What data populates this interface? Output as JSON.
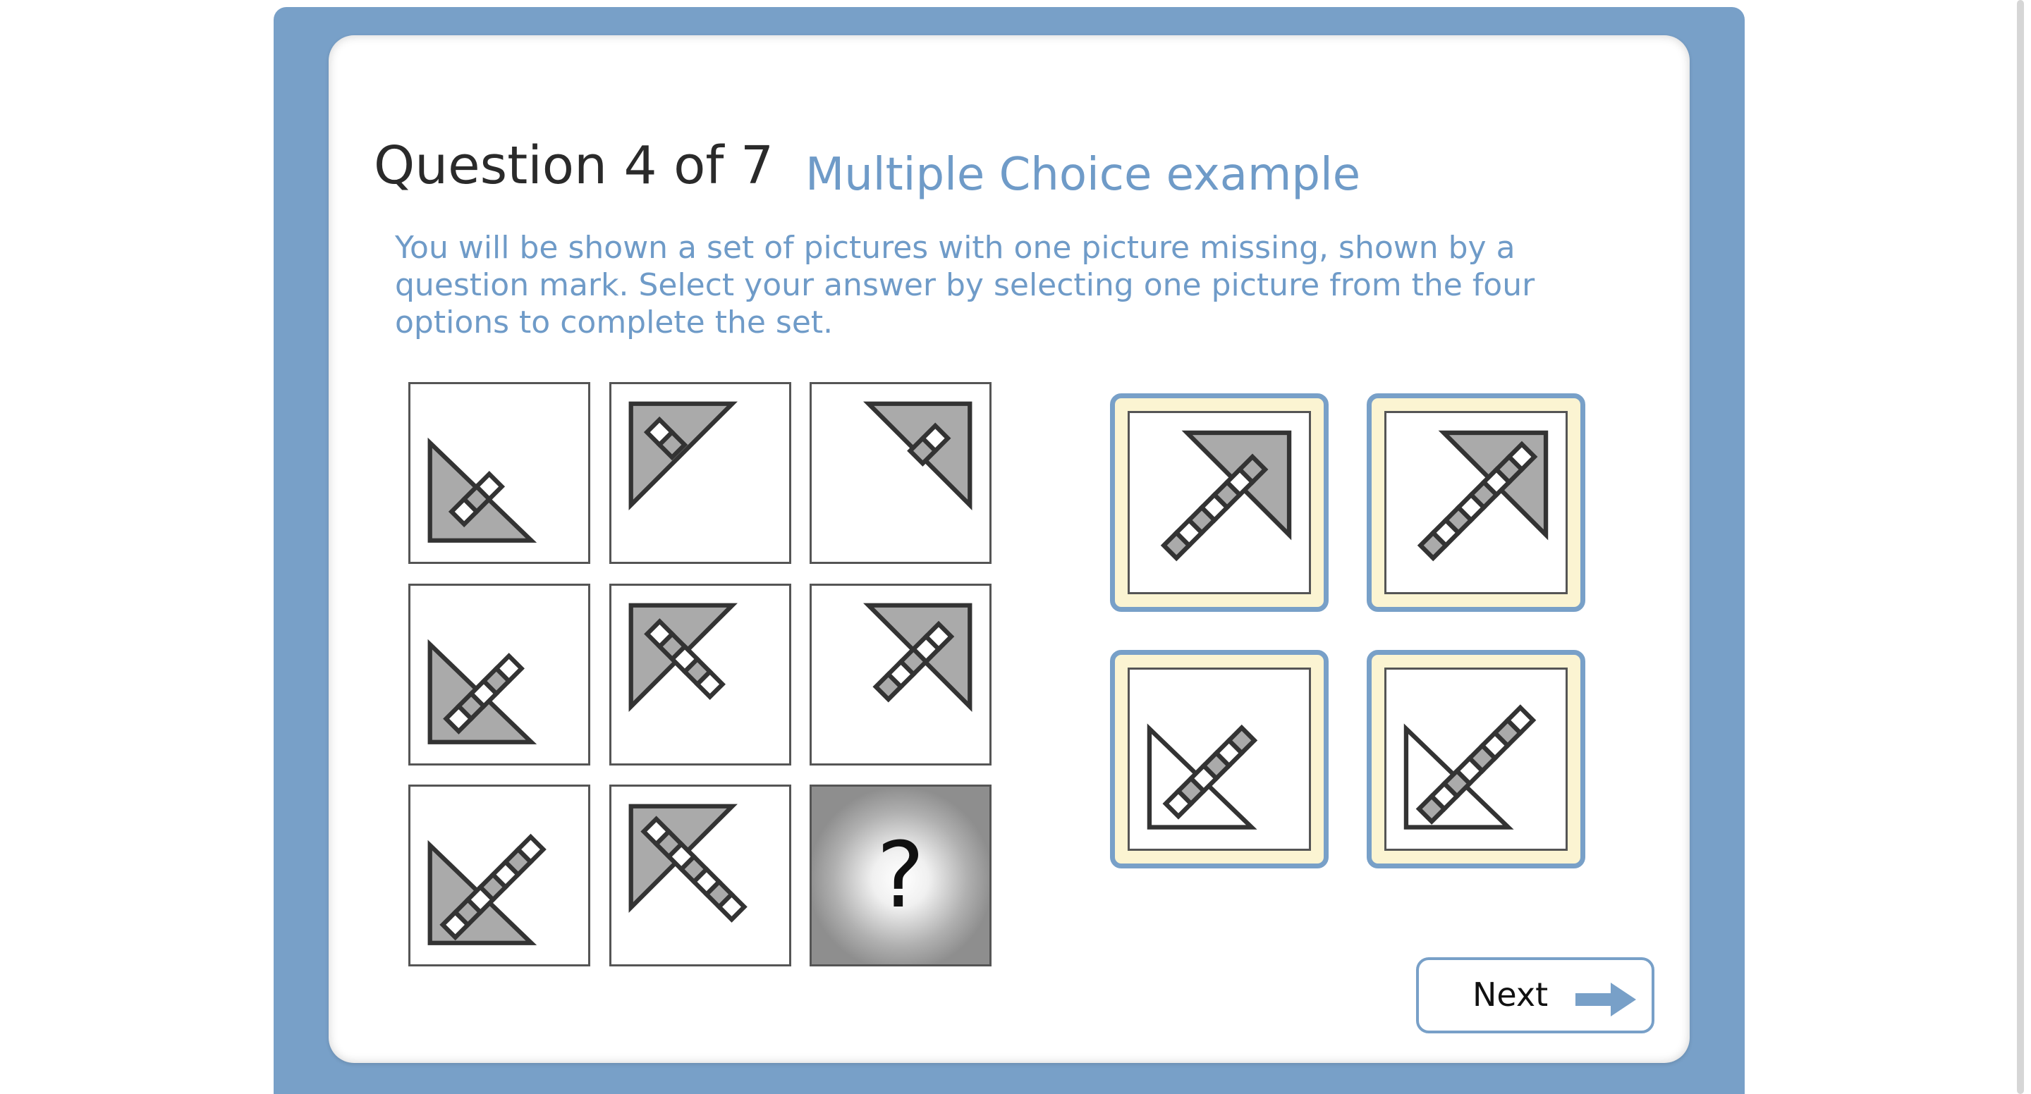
{
  "question": {
    "title": "Question 4 of 7",
    "subtitle": "Multiple Choice example",
    "instructions": "You will be shown a set of pictures with one picture missing, shown by a question mark. Select your answer by selecting one picture from the four options to complete the set."
  },
  "grid": {
    "missing_symbol": "?"
  },
  "nav": {
    "next_label": "Next",
    "next_icon": "arrow-right-icon"
  },
  "colors": {
    "frame": "#78a0c8",
    "accent_text": "#6f9bc8",
    "option_fill": "#fbf4d2",
    "shape_fill": "#aaaaaa"
  }
}
